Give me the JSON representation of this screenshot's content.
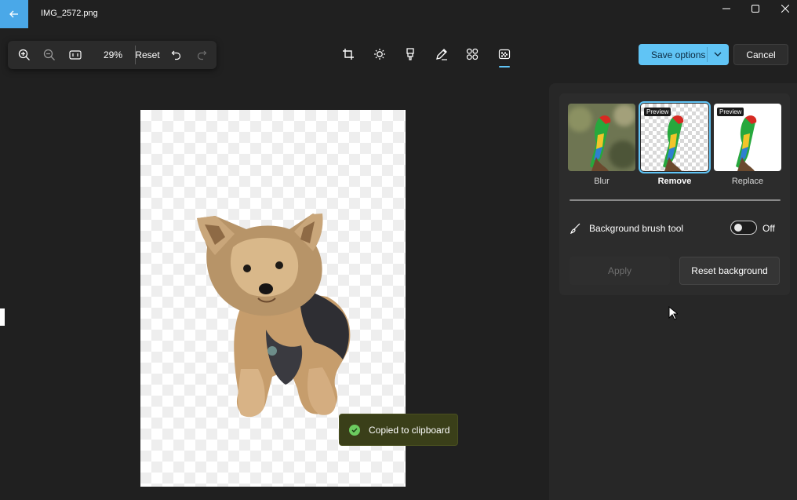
{
  "window": {
    "title": "IMG_2572.png",
    "accent": "#60c4f5",
    "back_icon": "arrow-left-icon",
    "controls": [
      "minimize-icon",
      "maximize-icon",
      "close-icon"
    ]
  },
  "zoom_toolbar": {
    "zoom_in_icon": "zoom-in-icon",
    "zoom_out_icon": "zoom-out-icon",
    "fit_icon": "fit-to-window-icon",
    "zoom_level": "29%",
    "reset_label": "Reset",
    "undo_icon": "undo-icon",
    "redo_icon": "redo-icon"
  },
  "edit_tools": [
    {
      "name": "crop",
      "icon": "crop-icon",
      "active": false
    },
    {
      "name": "adjust",
      "icon": "brightness-icon",
      "active": false
    },
    {
      "name": "retouch",
      "icon": "marker-icon",
      "active": false
    },
    {
      "name": "markup",
      "icon": "pen-icon",
      "active": false
    },
    {
      "name": "filters",
      "icon": "grid-icon",
      "active": false
    },
    {
      "name": "background",
      "icon": "background-icon",
      "active": true
    }
  ],
  "actions": {
    "save_label": "Save options",
    "cancel_label": "Cancel"
  },
  "toast": {
    "text": "Copied to clipboard",
    "icon": "check-circle-icon"
  },
  "background_panel": {
    "options": [
      {
        "label": "Blur",
        "tag": "",
        "selected": false
      },
      {
        "label": "Remove",
        "tag": "Preview",
        "selected": true
      },
      {
        "label": "Replace",
        "tag": "Preview",
        "selected": false
      }
    ],
    "brush_tool_label": "Background brush tool",
    "brush_tool_icon": "brush-icon",
    "brush_tool_state": "Off",
    "apply_label": "Apply",
    "reset_label": "Reset background"
  }
}
